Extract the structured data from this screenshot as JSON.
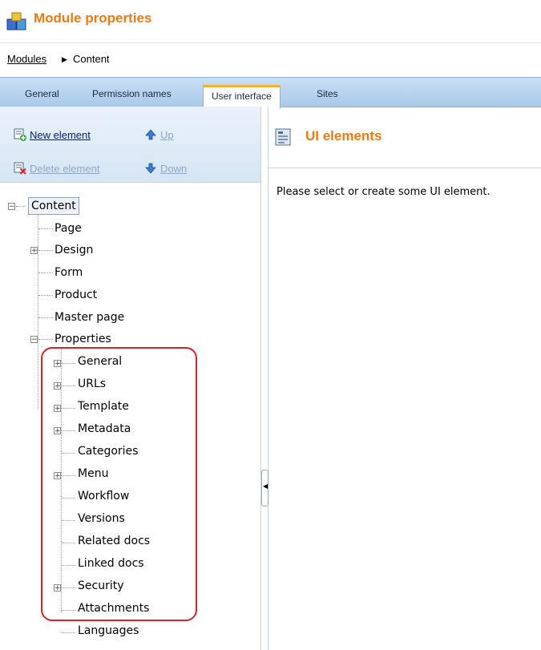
{
  "header": {
    "title": "Module properties"
  },
  "breadcrumb": {
    "link": "Modules",
    "arrow": "▶",
    "current": "Content"
  },
  "tabs": [
    {
      "label": "General"
    },
    {
      "label": "Permission names"
    },
    {
      "label": "User interface",
      "active": true
    },
    {
      "label": "Sites"
    }
  ],
  "toolbar": {
    "new_element": "New element",
    "up": "Up",
    "delete_element": "Delete element",
    "down": "Down"
  },
  "tree": {
    "root": "Content",
    "children": [
      "Page",
      "Design",
      "Form",
      "Product",
      "Master page",
      "Properties"
    ],
    "properties_children": [
      "General",
      "URLs",
      "Template",
      "Metadata",
      "Categories",
      "Menu",
      "Workflow",
      "Versions",
      "Related docs",
      "Linked docs",
      "Security",
      "Attachments",
      "Languages"
    ],
    "expand_symbol": "+",
    "collapse_symbol": "−"
  },
  "right_panel": {
    "title": "UI elements",
    "message": "Please select or create some UI element."
  },
  "colors": {
    "accent": "#f07a10",
    "highlight": "#d6232a",
    "tab_bar": "#b7d3ef"
  }
}
